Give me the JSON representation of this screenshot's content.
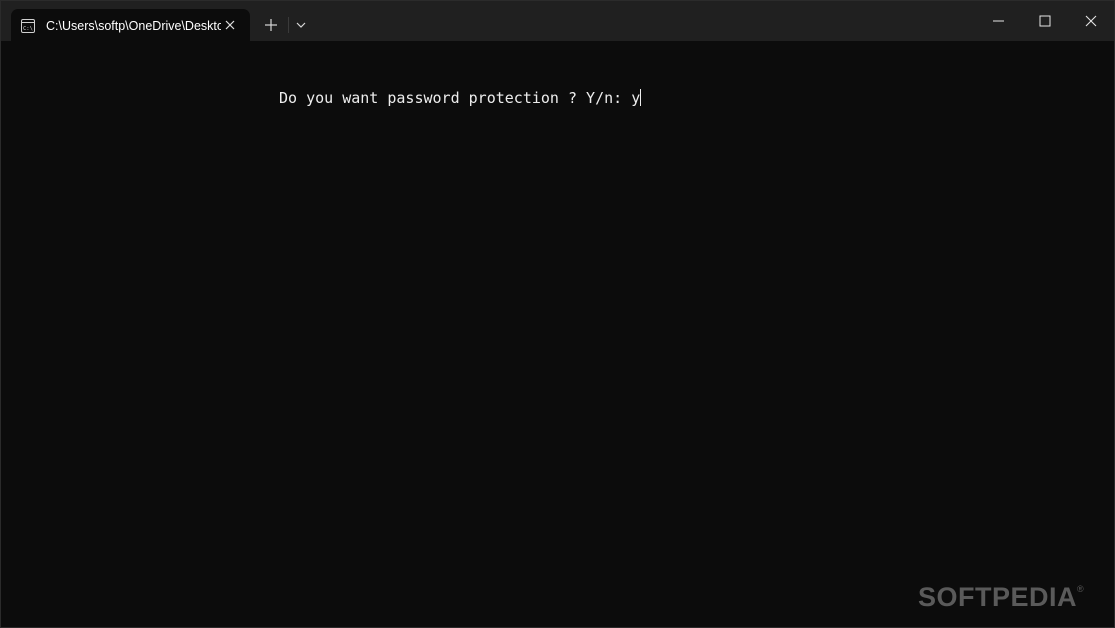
{
  "window": {
    "tab": {
      "title": "C:\\Users\\softp\\OneDrive\\Desktop",
      "icon": "console-icon"
    },
    "controls": {
      "new_tab_icon": "plus-icon",
      "dropdown_icon": "chevron-down-icon",
      "minimize_icon": "minimize-icon",
      "maximize_icon": "maximize-icon",
      "close_icon": "close-icon"
    }
  },
  "terminal": {
    "prompt": "Do you want password protection ? Y/n: ",
    "input": "y"
  },
  "watermark": {
    "text": "SOFTPEDIA",
    "mark": "®"
  },
  "colors": {
    "titlebar": "#202020",
    "terminal_background": "#0c0c0c",
    "terminal_text": "#ededed"
  }
}
